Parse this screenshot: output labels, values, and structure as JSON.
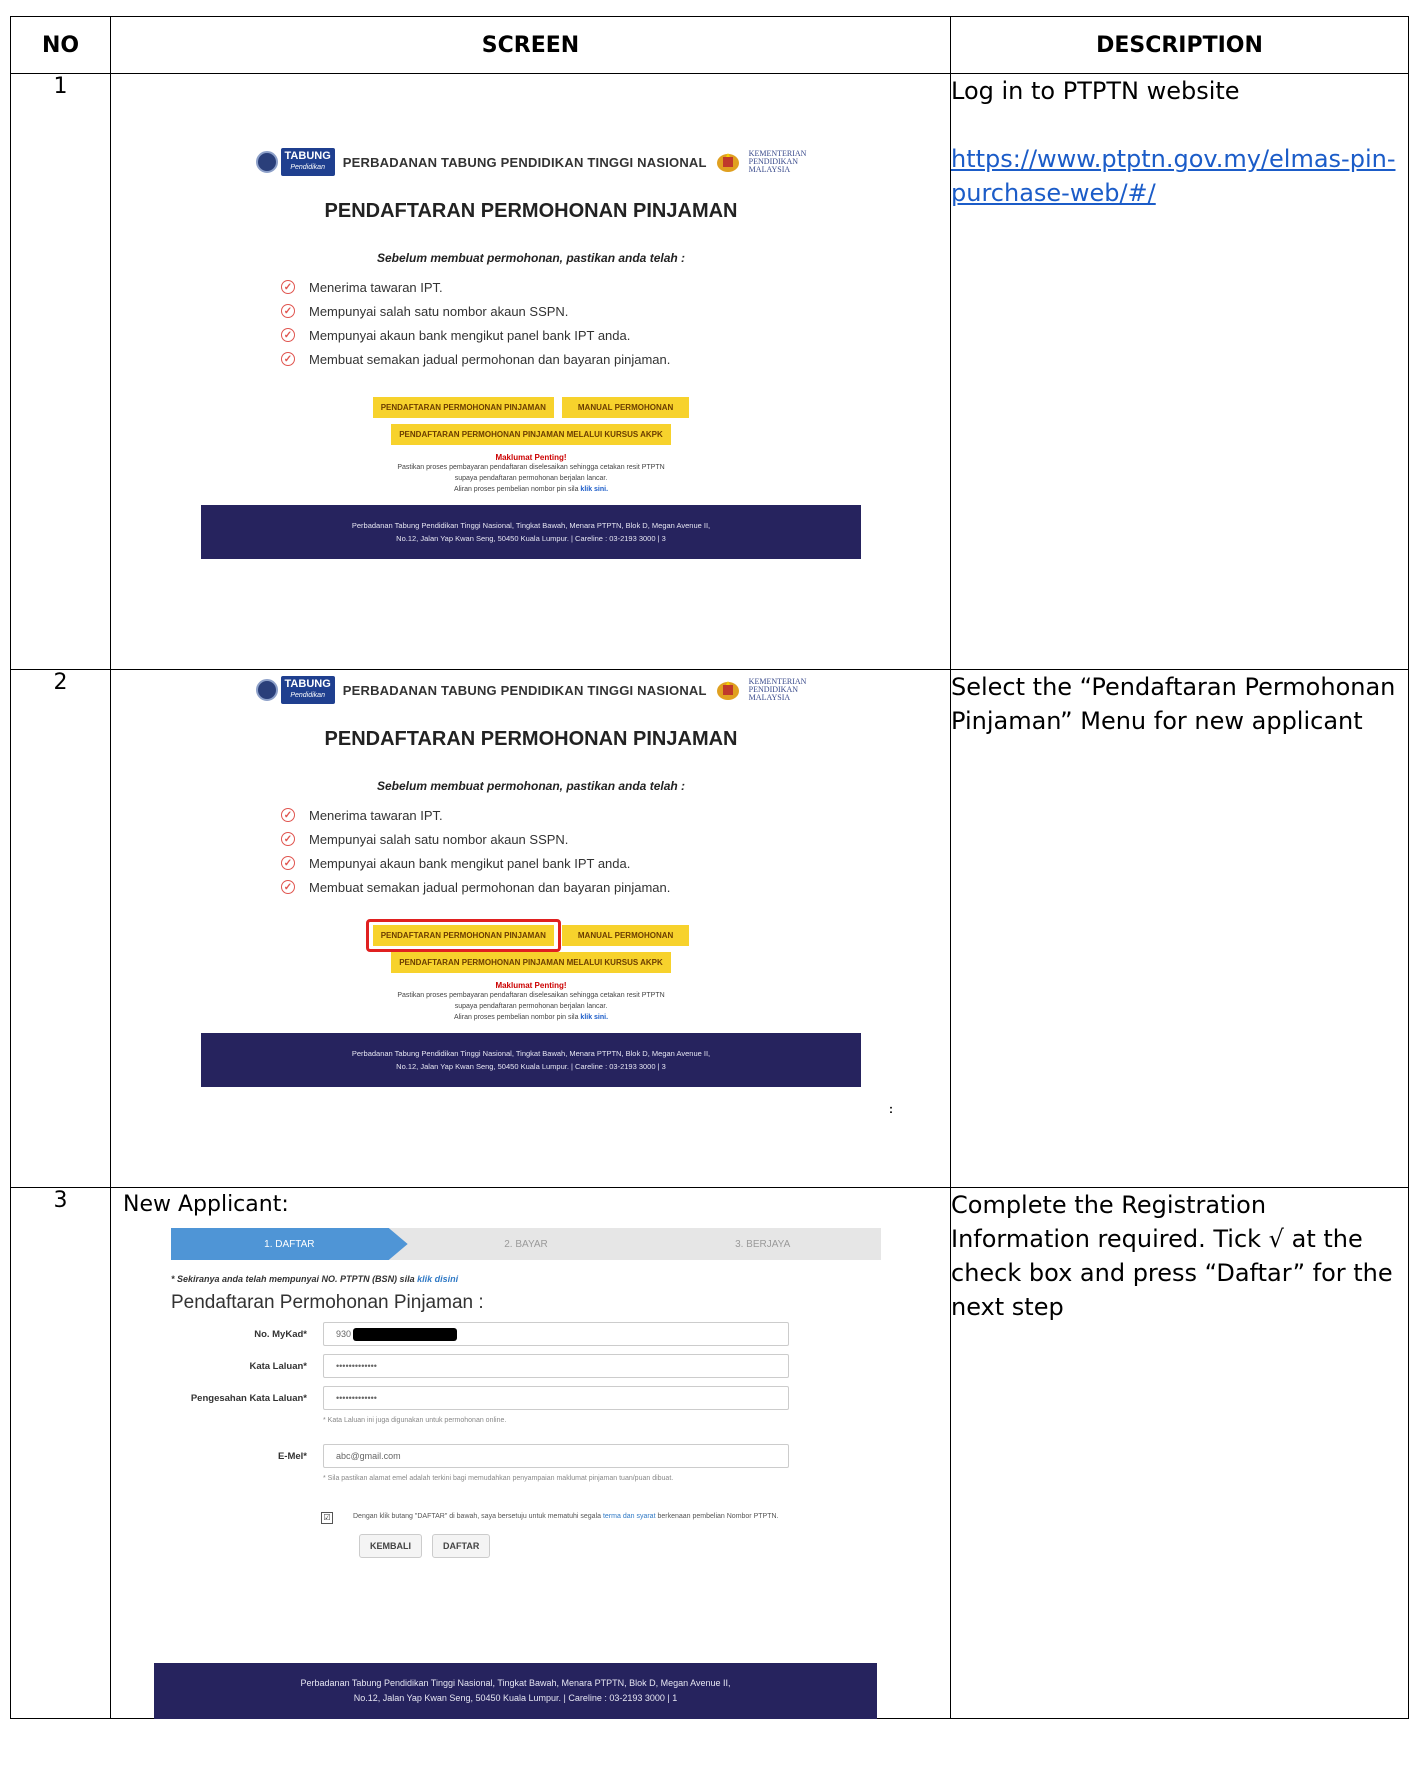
{
  "headers": {
    "no": "NO",
    "screen": "SCREEN",
    "description": "DESCRIPTION"
  },
  "homepage": {
    "logo_text": "TABUNG",
    "logo_sub": "Pendidikan",
    "org_name": "PERBADANAN TABUNG PENDIDIKAN TINGGI NASIONAL",
    "ministry_lines": [
      "KEMENTERIAN",
      "PENDIDIKAN",
      "MALAYSIA"
    ],
    "title": "PENDAFTARAN PERMOHONAN PINJAMAN",
    "subtitle": "Sebelum membuat permohonan, pastikan anda telah :",
    "checklist": [
      "Menerima tawaran IPT.",
      "Mempunyai salah satu nombor akaun SSPN.",
      "Mempunyai akaun bank mengikut panel bank IPT anda.",
      "Membuat semakan jadual permohonan dan bayaran pinjaman."
    ],
    "btn_register": "PENDAFTARAN PERMOHONAN PINJAMAN",
    "btn_manual": "MANUAL PERMOHONAN",
    "btn_akpk": "PENDAFTARAN PERMOHONAN PINJAMAN MELALUI KURSUS AKPK",
    "notice_title": "Maklumat Penting!",
    "notice_line1": "Pastikan proses pembayaran pendaftaran diselesaikan sehingga cetakan resit PTPTN",
    "notice_line2": "supaya pendaftaran permohonan berjalan lancar.",
    "notice_line3": "Aliran proses pembelian nombor pin sila",
    "notice_link": "klik sini.",
    "footer_line1": "Perbadanan Tabung Pendidikan Tinggi Nasional, Tingkat Bawah, Menara PTPTN, Blok D, Megan Avenue II,",
    "footer_line2": "No.12, Jalan Yap Kwan Seng, 50450 Kuala Lumpur. | Careline : 03-2193 3000 | 3"
  },
  "rows": [
    {
      "no": "1",
      "desc": "Log in to PTPTN website",
      "link": "https://www.ptptn.gov.my/elmas-pin-purchase-web/#/"
    },
    {
      "no": "2",
      "desc": "Select the “Pendaftaran Permohonan Pinjaman” Menu for new applicant",
      "side_mark": ":"
    },
    {
      "no": "3",
      "screen_label": "New Applicant:",
      "desc": "Complete the Registration Information required. Tick √ at the check box and press “Daftar” for the next step",
      "form": {
        "steps": [
          "1. DAFTAR",
          "2. BAYAR",
          "3. BERJAYA"
        ],
        "bsn_note": "* Sekiranya anda telah mempunyai NO. PTPTN (BSN) sila",
        "bsn_link": "klik disini",
        "title": "Pendaftaran Permohonan Pinjaman :",
        "mykad_label": "No. MyKad*",
        "mykad_value": "930",
        "password_label": "Kata Laluan*",
        "password_value": "•••••••••••••",
        "confirm_label": "Pengesahan Kata Laluan*",
        "confirm_value": "•••••••••••••",
        "password_hint": "* Kata Laluan ini juga digunakan untuk permohonan online.",
        "email_label": "E-Mel*",
        "email_value": "abc@gmail.com",
        "email_hint": "* Sila pastikan alamat emel adalah terkini bagi memudahkan penyampaian maklumat pinjaman tuan/puan dibuat.",
        "checkbox_mark": "☑",
        "consent_text": "Dengan klik butang \"DAFTAR\" di bawah, saya bersetuju untuk mematuhi segala",
        "consent_link": "terma dan syarat",
        "consent_text2": "berkenaan pembelian Nombor PTPTN.",
        "btn_back": "KEMBALI",
        "btn_submit": "DAFTAR",
        "footer_line1": "Perbadanan Tabung Pendidikan Tinggi Nasional, Tingkat Bawah, Menara PTPTN, Blok D, Megan Avenue II,",
        "footer_line2": "No.12, Jalan Yap Kwan Seng, 50450 Kuala Lumpur. | Careline : 03-2193 3000 | 1"
      }
    }
  ],
  "colors": {
    "accent_yellow": "#f7d22c",
    "footer_navy": "#26235e",
    "highlight_red": "#e02020",
    "step_blue": "#4f95d6",
    "link_blue": "#1b5cc8"
  },
  "icons": {
    "check": "check-circle-icon",
    "logo": "ptptn-logo",
    "crest": "malaysia-crest-icon"
  }
}
